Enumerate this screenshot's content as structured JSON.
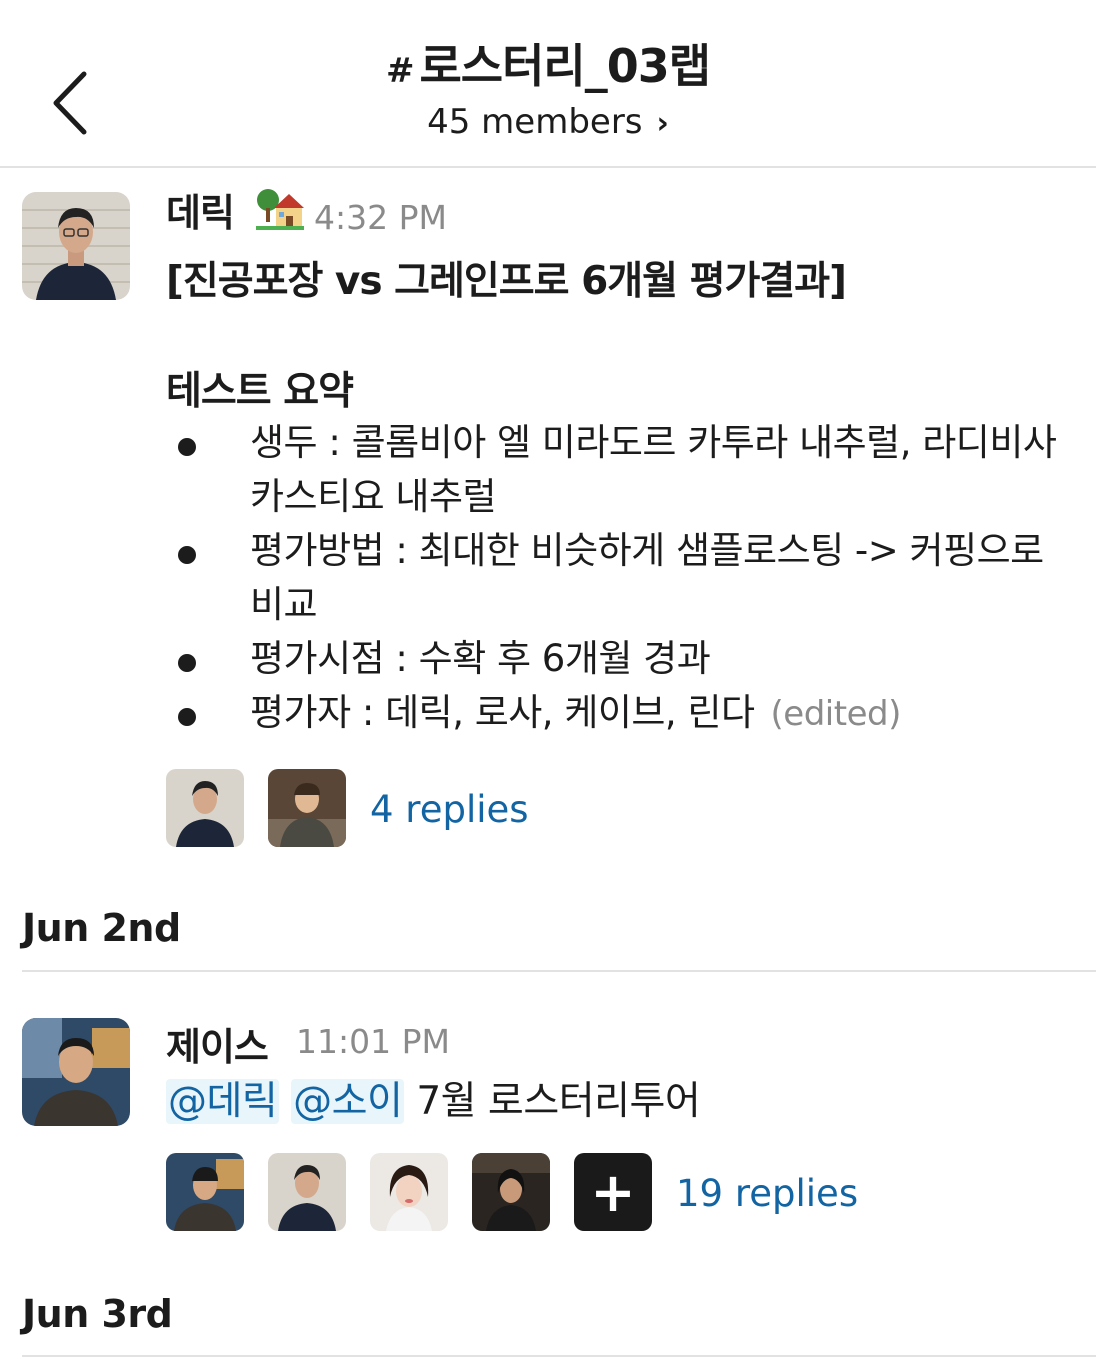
{
  "header": {
    "hash": "#",
    "channel_name": "로스터리_03랩",
    "members_label": "45 members",
    "members_chevron": "›"
  },
  "icons": {
    "back": "chevron-left-icon",
    "status_emoji": "house-with-garden-emoji",
    "add_reaction": "plus-icon"
  },
  "messages": [
    {
      "sender": "데릭",
      "time": "4:32 PM",
      "title": "[진공포장 vs 그레인프로 6개월 평가결과]",
      "heading": "테스트 요약",
      "bullets": [
        "생두 : 콜롬비아 엘 미라도르 카투라 내추럴, 라디비사 카스티요 내추럴",
        "평가방법 : 최대한 비슷하게 샘플로스팅 -> 커핑으로 비교",
        "평가시점 : 수확 후 6개월 경과",
        "평가자 : 데릭, 로사, 케이브, 린다"
      ],
      "edited": "(edited)",
      "replies": "4 replies"
    },
    {
      "sender": "제이스",
      "time": "11:01 PM",
      "mention1": "@데릭",
      "mention2": "@소이",
      "text": "7월 로스터리투어",
      "plus": "+",
      "replies": "19 replies"
    }
  ],
  "dates": [
    "Jun 2nd",
    "Jun 3rd"
  ],
  "colors": {
    "link": "#1264a3",
    "mention_bg": "#e8f5fa",
    "muted": "#8a8a8a",
    "text": "#1d1c1d",
    "divider": "#e2e2e2"
  }
}
